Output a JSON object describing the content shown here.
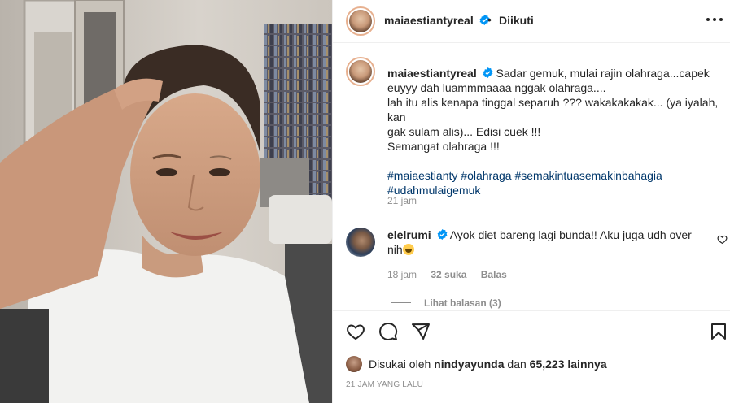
{
  "header": {
    "username": "maiaestiantyreal",
    "separator": "•",
    "follow_label": "Diikuti"
  },
  "caption": {
    "username": "maiaestiantyreal",
    "lines": [
      "Sadar gemuk, mulai rajin olahraga...capek",
      "euyyy dah luammmaaaa nggak olahraga....",
      "lah itu alis kenapa tinggal separuh ??? wakakakakak... (ya iyalah, kan",
      "gak sulam alis)... Edisi cuek !!!",
      "Semangat olahraga !!!"
    ],
    "hashtags": [
      "#maiaestianty",
      "#olahraga",
      "#semakintuasemakinbahagia",
      "#udahmulaigemuk"
    ],
    "time": "21 jam"
  },
  "comment": {
    "username": "elelrumi",
    "text_line1": "Ayok diet bareng lagi bunda!! Aku juga udh over",
    "text_line2": "nih",
    "time": "18 jam",
    "likes": "32 suka",
    "reply_label": "Balas",
    "view_replies": "Lihat balasan (3)"
  },
  "likes": {
    "prefix": "Disukai oleh",
    "user": "nindyayunda",
    "conj": "dan",
    "count": "65,223",
    "suffix": "lainnya"
  },
  "post_time": "21 JAM YANG LALU",
  "icons": {
    "verified": "verified-badge-icon",
    "more": "more-options-icon",
    "like": "heart-icon",
    "comment": "comment-icon",
    "share": "share-icon",
    "save": "bookmark-icon"
  },
  "colors": {
    "verified": "#0095f6",
    "hashtag": "#00376b",
    "muted": "#8e8e8e",
    "border": "#efefef"
  }
}
